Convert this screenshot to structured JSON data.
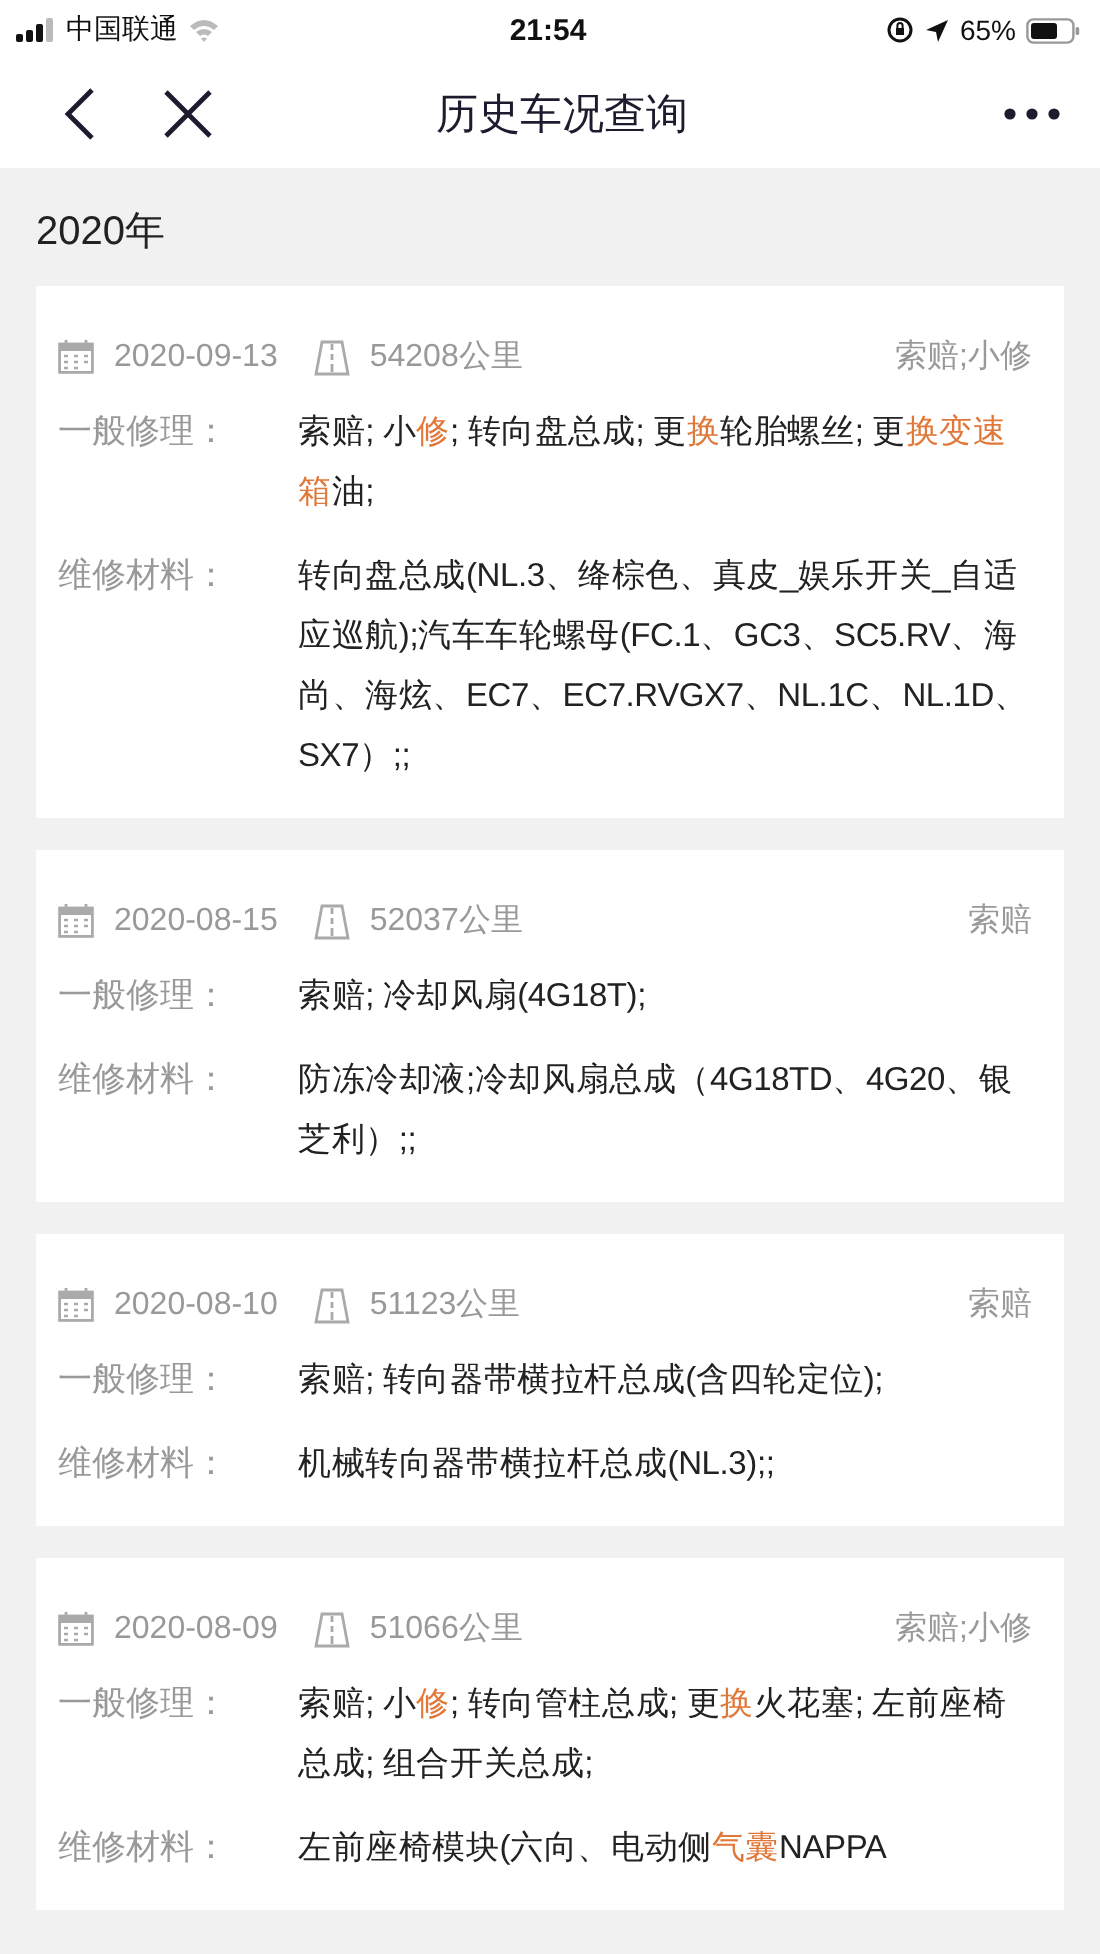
{
  "status_bar": {
    "carrier": "中国联通",
    "time": "21:54",
    "battery": "65%"
  },
  "nav": {
    "title": "历史车况查询"
  },
  "year": "2020年",
  "records": [
    {
      "date": "2020-09-13",
      "mileage": "54208公里",
      "type": "索赔;小修",
      "rows": [
        {
          "label": "一般修理：",
          "parts": [
            {
              "text": "索赔; 小",
              "highlighted": false
            },
            {
              "text": "修",
              "highlighted": true
            },
            {
              "text": "; 转向盘总成; 更",
              "highlighted": false
            },
            {
              "text": "换",
              "highlighted": true
            },
            {
              "text": "轮胎螺丝; 更",
              "highlighted": false
            },
            {
              "text": "换变速箱",
              "highlighted": true
            },
            {
              "text": "油;",
              "highlighted": false
            }
          ]
        },
        {
          "label": "维修材料：",
          "parts": [
            {
              "text": "转向盘总成(NL.3、绛棕色、真皮_娱乐开关_自适应巡航);汽车车轮螺母(FC.1、GC3、SC5.RV、海尚、海炫、EC7、EC7.RVGX7、NL.1C、NL.1D、SX7）;;",
              "highlighted": false
            }
          ]
        }
      ]
    },
    {
      "date": "2020-08-15",
      "mileage": "52037公里",
      "type": "索赔",
      "rows": [
        {
          "label": "一般修理：",
          "parts": [
            {
              "text": "索赔; 冷却风扇(4G18T);",
              "highlighted": false
            }
          ]
        },
        {
          "label": "维修材料：",
          "parts": [
            {
              "text": "防冻冷却液;冷却风扇总成（4G18TD、4G20、银芝利）;;",
              "highlighted": false
            }
          ]
        }
      ]
    },
    {
      "date": "2020-08-10",
      "mileage": "51123公里",
      "type": "索赔",
      "rows": [
        {
          "label": "一般修理：",
          "parts": [
            {
              "text": "索赔; 转向器带横拉杆总成(含四轮定位);",
              "highlighted": false
            }
          ]
        },
        {
          "label": "维修材料：",
          "parts": [
            {
              "text": "机械转向器带横拉杆总成(NL.3);;",
              "highlighted": false
            }
          ]
        }
      ]
    },
    {
      "date": "2020-08-09",
      "mileage": "51066公里",
      "type": "索赔;小修",
      "rows": [
        {
          "label": "一般修理：",
          "parts": [
            {
              "text": "索赔; 小",
              "highlighted": false
            },
            {
              "text": "修",
              "highlighted": true
            },
            {
              "text": "; 转向管柱总成; 更",
              "highlighted": false
            },
            {
              "text": "换",
              "highlighted": true
            },
            {
              "text": "火花塞; 左前座椅总成; 组合开关总成;",
              "highlighted": false
            }
          ]
        },
        {
          "label": "维修材料：",
          "parts": [
            {
              "text": "左前座椅模块(六向、电动侧",
              "highlighted": false
            },
            {
              "text": "气囊",
              "highlighted": true
            },
            {
              "text": "NAPPA",
              "highlighted": false
            }
          ]
        }
      ]
    }
  ]
}
